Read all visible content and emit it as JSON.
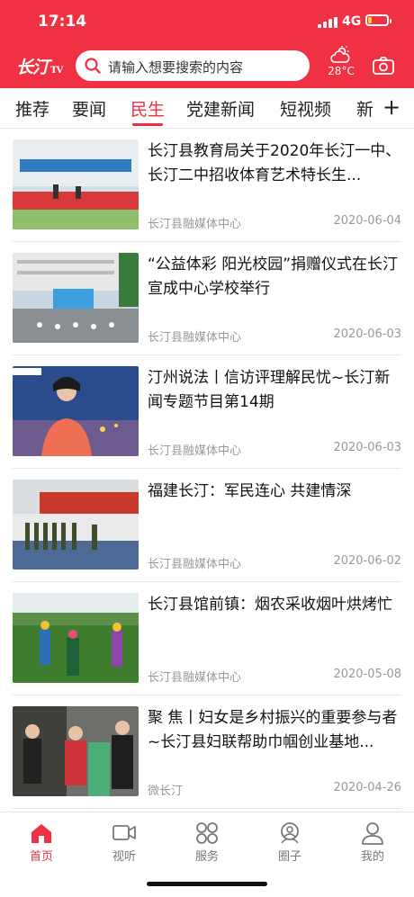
{
  "status_bar": {
    "time": "17:14",
    "network": "4G"
  },
  "header": {
    "logo_text": "长汀",
    "logo_sub": "TV",
    "search_placeholder": "请输入想要搜索的内容",
    "weather_temp": "28°C",
    "colors": {
      "brand": "#f03043"
    }
  },
  "tabs": [
    {
      "label": "推荐"
    },
    {
      "label": "要闻"
    },
    {
      "label": "民生",
      "active": true
    },
    {
      "label": "党建新闻"
    },
    {
      "label": "短视频"
    },
    {
      "label": "新"
    }
  ],
  "tab_add": "+",
  "feed": [
    {
      "title": "长汀县教育局关于2020年长汀一中、长汀二中招收体育艺术特长生...",
      "source": "长汀县融媒体中心",
      "date": "2020-06-04"
    },
    {
      "title": "“公益体彩 阳光校园”捐赠仪式在长汀宣成中心学校举行",
      "source": "长汀县融媒体中心",
      "date": "2020-06-03"
    },
    {
      "title": "汀州说法丨信访评理解民忧~长汀新闻专题节目第14期",
      "source": "长汀县融媒体中心",
      "date": "2020-06-03"
    },
    {
      "title": "福建长汀：军民连心 共建情深",
      "source": "长汀县融媒体中心",
      "date": "2020-06-02"
    },
    {
      "title": "长汀县馆前镇：烟农采收烟叶烘烤忙",
      "source": "长汀县融媒体中心",
      "date": "2020-05-08"
    },
    {
      "title": "聚 焦丨妇女是乡村振兴的重要参与者~长汀县妇联帮助巾帼创业基地...",
      "source": "微长汀",
      "date": "2020-04-26"
    }
  ],
  "tabbar": [
    {
      "label": "首页",
      "icon": "home-icon",
      "active": true
    },
    {
      "label": "视听",
      "icon": "video-icon"
    },
    {
      "label": "服务",
      "icon": "services-icon"
    },
    {
      "label": "圈子",
      "icon": "community-icon"
    },
    {
      "label": "我的",
      "icon": "profile-icon"
    }
  ]
}
